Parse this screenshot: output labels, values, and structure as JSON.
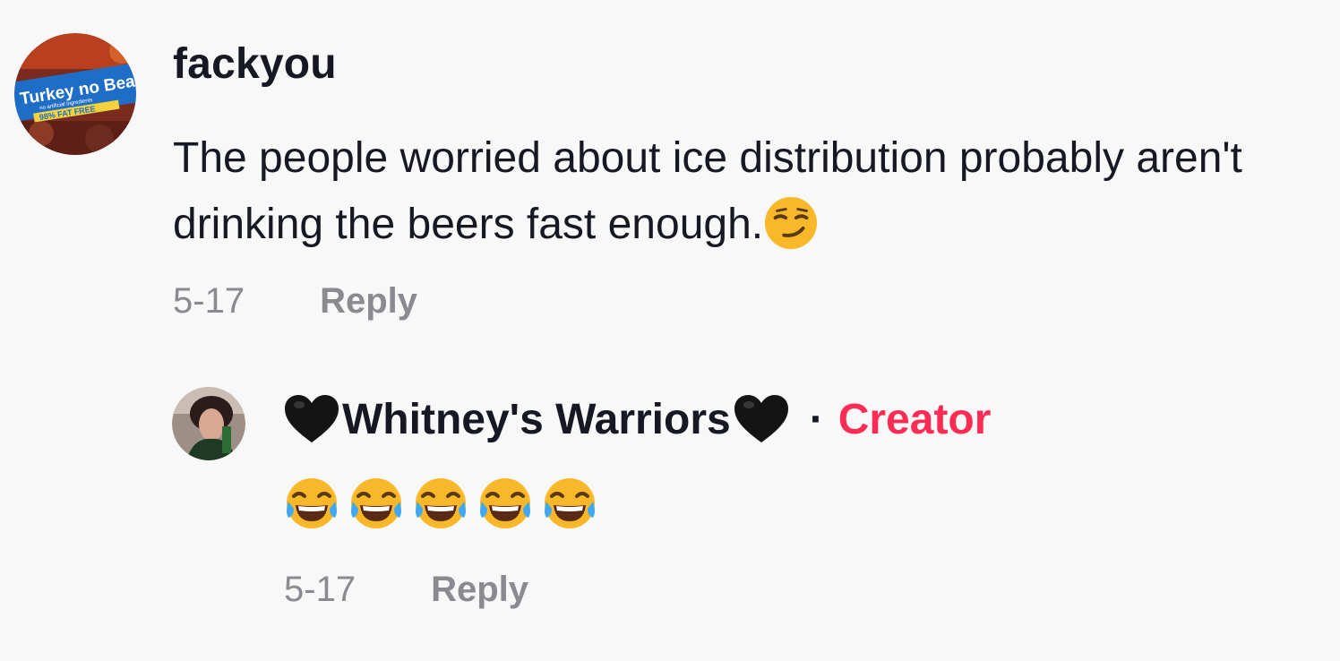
{
  "comment": {
    "username": "fackyou",
    "avatar_text_line1": "Turkey no Beans",
    "avatar_text_line2": "no artificial ingredients",
    "avatar_text_line3": "98% FAT FREE",
    "text": "The people worried about ice distribution probably aren't drinking the beers fast enough.",
    "text_emoji": "smirking-face",
    "date": "5-17",
    "reply_label": "Reply"
  },
  "reply": {
    "username": "Whitney's Warriors",
    "name_decoration": "black-heart",
    "separator": "·",
    "badge": "Creator",
    "emoji": "face-with-tears-of-joy",
    "emoji_count": 5,
    "date": "5-17",
    "reply_label": "Reply"
  },
  "colors": {
    "background": "#f8f8f8",
    "text_primary": "#161823",
    "text_secondary": "#8a8b91",
    "creator_accent": "#fe2c55"
  }
}
